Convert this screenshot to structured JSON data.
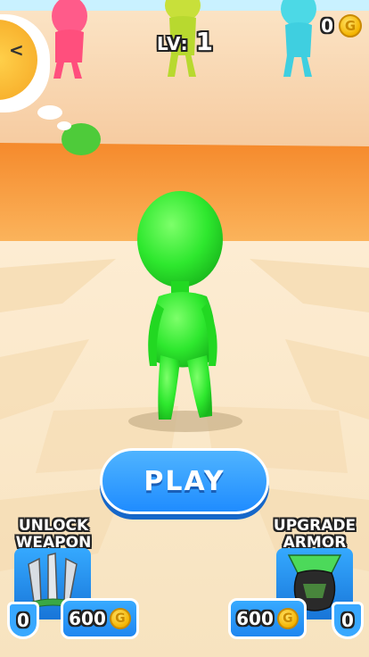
{
  "hud": {
    "level_prefix": "LV:",
    "level_value": "1",
    "coins": "0",
    "coin_glyph": "G"
  },
  "play_label": "PLAY",
  "upgrades": {
    "weapon": {
      "title_line1": "UNLOCK",
      "title_line2": "WEAPON",
      "level": "0",
      "price": "600"
    },
    "armor": {
      "title_line1": "UPGRADE",
      "title_line2": "ARMOR",
      "level": "0",
      "price": "600"
    }
  },
  "colors": {
    "player": "#2ee82e",
    "button": "#1f8cff",
    "floor_orange": "#f7a042",
    "coin": "#f4b400"
  },
  "icons": [
    "sad-emoji-icon",
    "coin-icon",
    "knives-icon",
    "helmet-icon",
    "shield-icon"
  ]
}
